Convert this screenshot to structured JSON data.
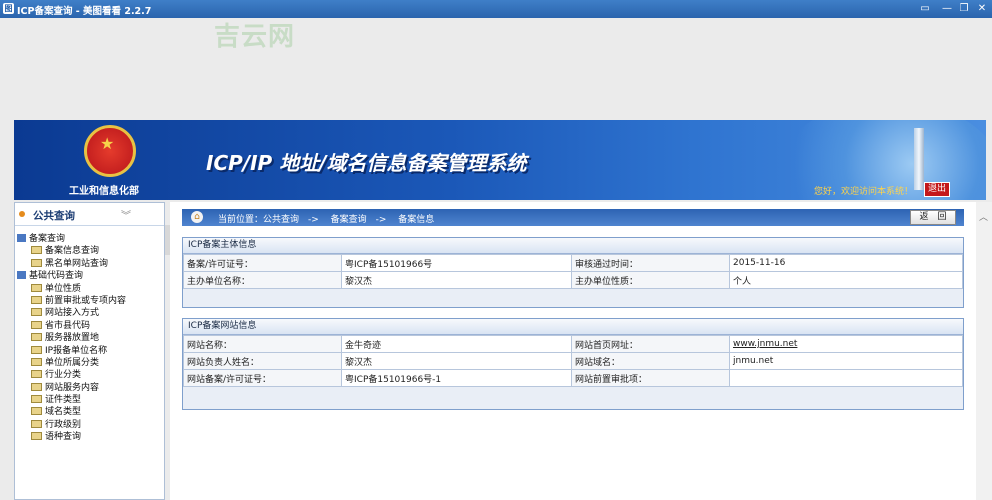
{
  "window": {
    "title": "ICP备案查询 - 美图看看 2.2.7",
    "icon": "app-icon",
    "controls": [
      "▭",
      "—",
      "❐",
      "✕"
    ]
  },
  "watermark": "吉云网",
  "banner": {
    "ministry": "工业和信息化部",
    "system_title": "ICP/IP 地址/域名信息备案管理系统",
    "welcome": "您好，欢迎访问本系统！",
    "logout": "退出"
  },
  "sidebar": {
    "title": "公共查询",
    "tree": [
      {
        "label": "备案查询",
        "type": "root"
      },
      {
        "label": "备案信息查询",
        "type": "leaf"
      },
      {
        "label": "黑名单网站查询",
        "type": "leaf"
      },
      {
        "label": "基础代码查询",
        "type": "root"
      },
      {
        "label": "单位性质",
        "type": "leaf"
      },
      {
        "label": "前置审批或专项内容",
        "type": "leaf"
      },
      {
        "label": "网站接入方式",
        "type": "leaf"
      },
      {
        "label": "省市县代码",
        "type": "leaf"
      },
      {
        "label": "服务器放置地",
        "type": "leaf"
      },
      {
        "label": "IP报备单位名称",
        "type": "leaf"
      },
      {
        "label": "单位所属分类",
        "type": "leaf"
      },
      {
        "label": "行业分类",
        "type": "leaf"
      },
      {
        "label": "网站服务内容",
        "type": "leaf"
      },
      {
        "label": "证件类型",
        "type": "leaf"
      },
      {
        "label": "域名类型",
        "type": "leaf"
      },
      {
        "label": "行政级别",
        "type": "leaf"
      },
      {
        "label": "语种查询",
        "type": "leaf"
      }
    ]
  },
  "breadcrumb": "当前位置：公共查询　-> 　备案查询　-> 　备案信息",
  "back_button": "返　回",
  "panel_subject": {
    "title": "ICP备案主体信息",
    "rows": [
      [
        "备案/许可证号：",
        "粤ICP备15101966号",
        "审核通过时间：",
        "2015-11-16"
      ],
      [
        "主办单位名称：",
        "黎汉杰",
        "主办单位性质：",
        "个人"
      ]
    ]
  },
  "panel_site": {
    "title": "ICP备案网站信息",
    "rows": [
      [
        "网站名称：",
        "金牛奇迹",
        "网站首页网址：",
        "www.jnmu.net"
      ],
      [
        "网站负责人姓名：",
        "黎汉杰",
        "网站域名：",
        "jnmu.net"
      ],
      [
        "网站备案/许可证号：",
        "粤ICP备15101966号-1",
        "网站前置审批项：",
        ""
      ]
    ]
  }
}
